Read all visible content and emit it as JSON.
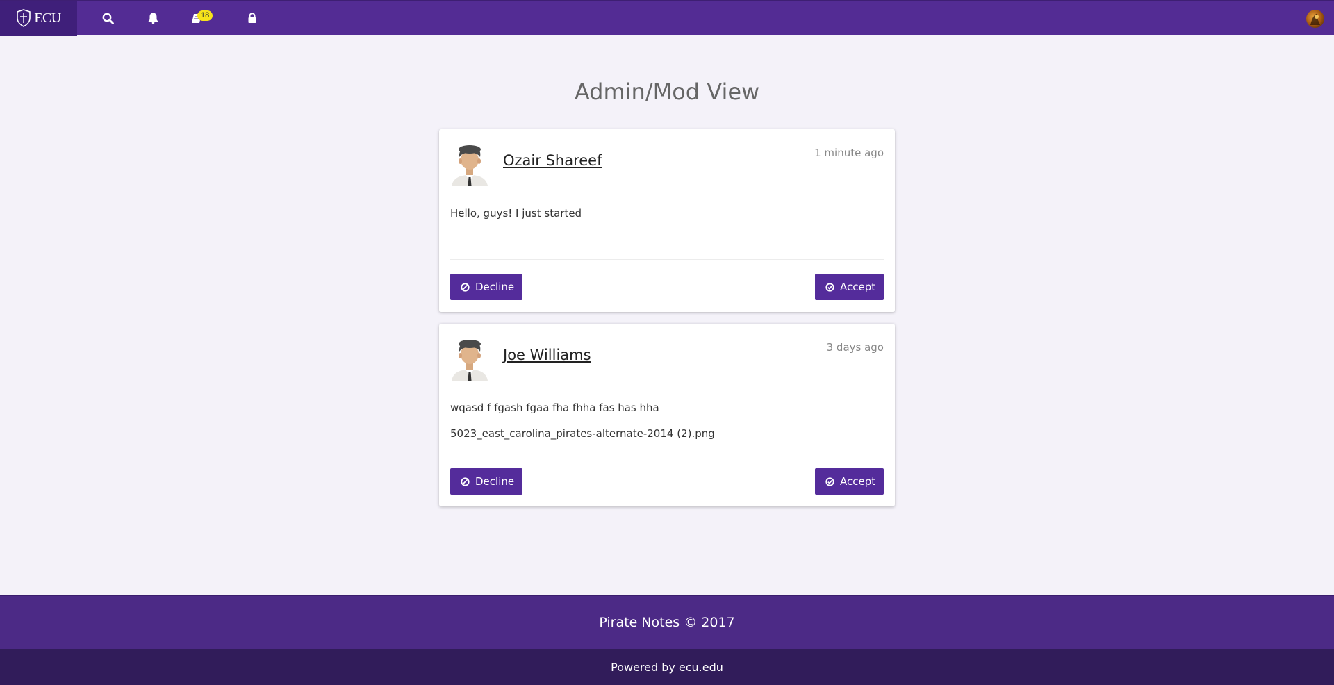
{
  "navbar": {
    "brand_text": "ECU",
    "notes_badge": "18",
    "colors": {
      "bar": "#532c94",
      "brand_bg": "#3f1f7a",
      "badge": "#f7e31b"
    },
    "icons": [
      "shield-logo-icon",
      "search-icon",
      "bell-icon",
      "notebook-icon",
      "lock-icon",
      "user-avatar"
    ]
  },
  "page": {
    "title": "Admin/Mod View"
  },
  "posts": [
    {
      "author": "Ozair Shareef",
      "time": "1 minute ago",
      "content": "Hello, guys! I just started",
      "attachment": "",
      "decline_label": "Decline",
      "accept_label": "Accept"
    },
    {
      "author": "Joe Williams",
      "time": "3 days ago",
      "content": "wqasd f fgash fgaa fha fhha fas has hha",
      "attachment": "5023_east_carolina_pirates-alternate-2014 (2).png",
      "decline_label": "Decline",
      "accept_label": "Accept"
    }
  ],
  "footer": {
    "copyright": "Pirate Notes © 2017",
    "powered_prefix": "Powered by",
    "powered_link": "ecu.edu"
  }
}
